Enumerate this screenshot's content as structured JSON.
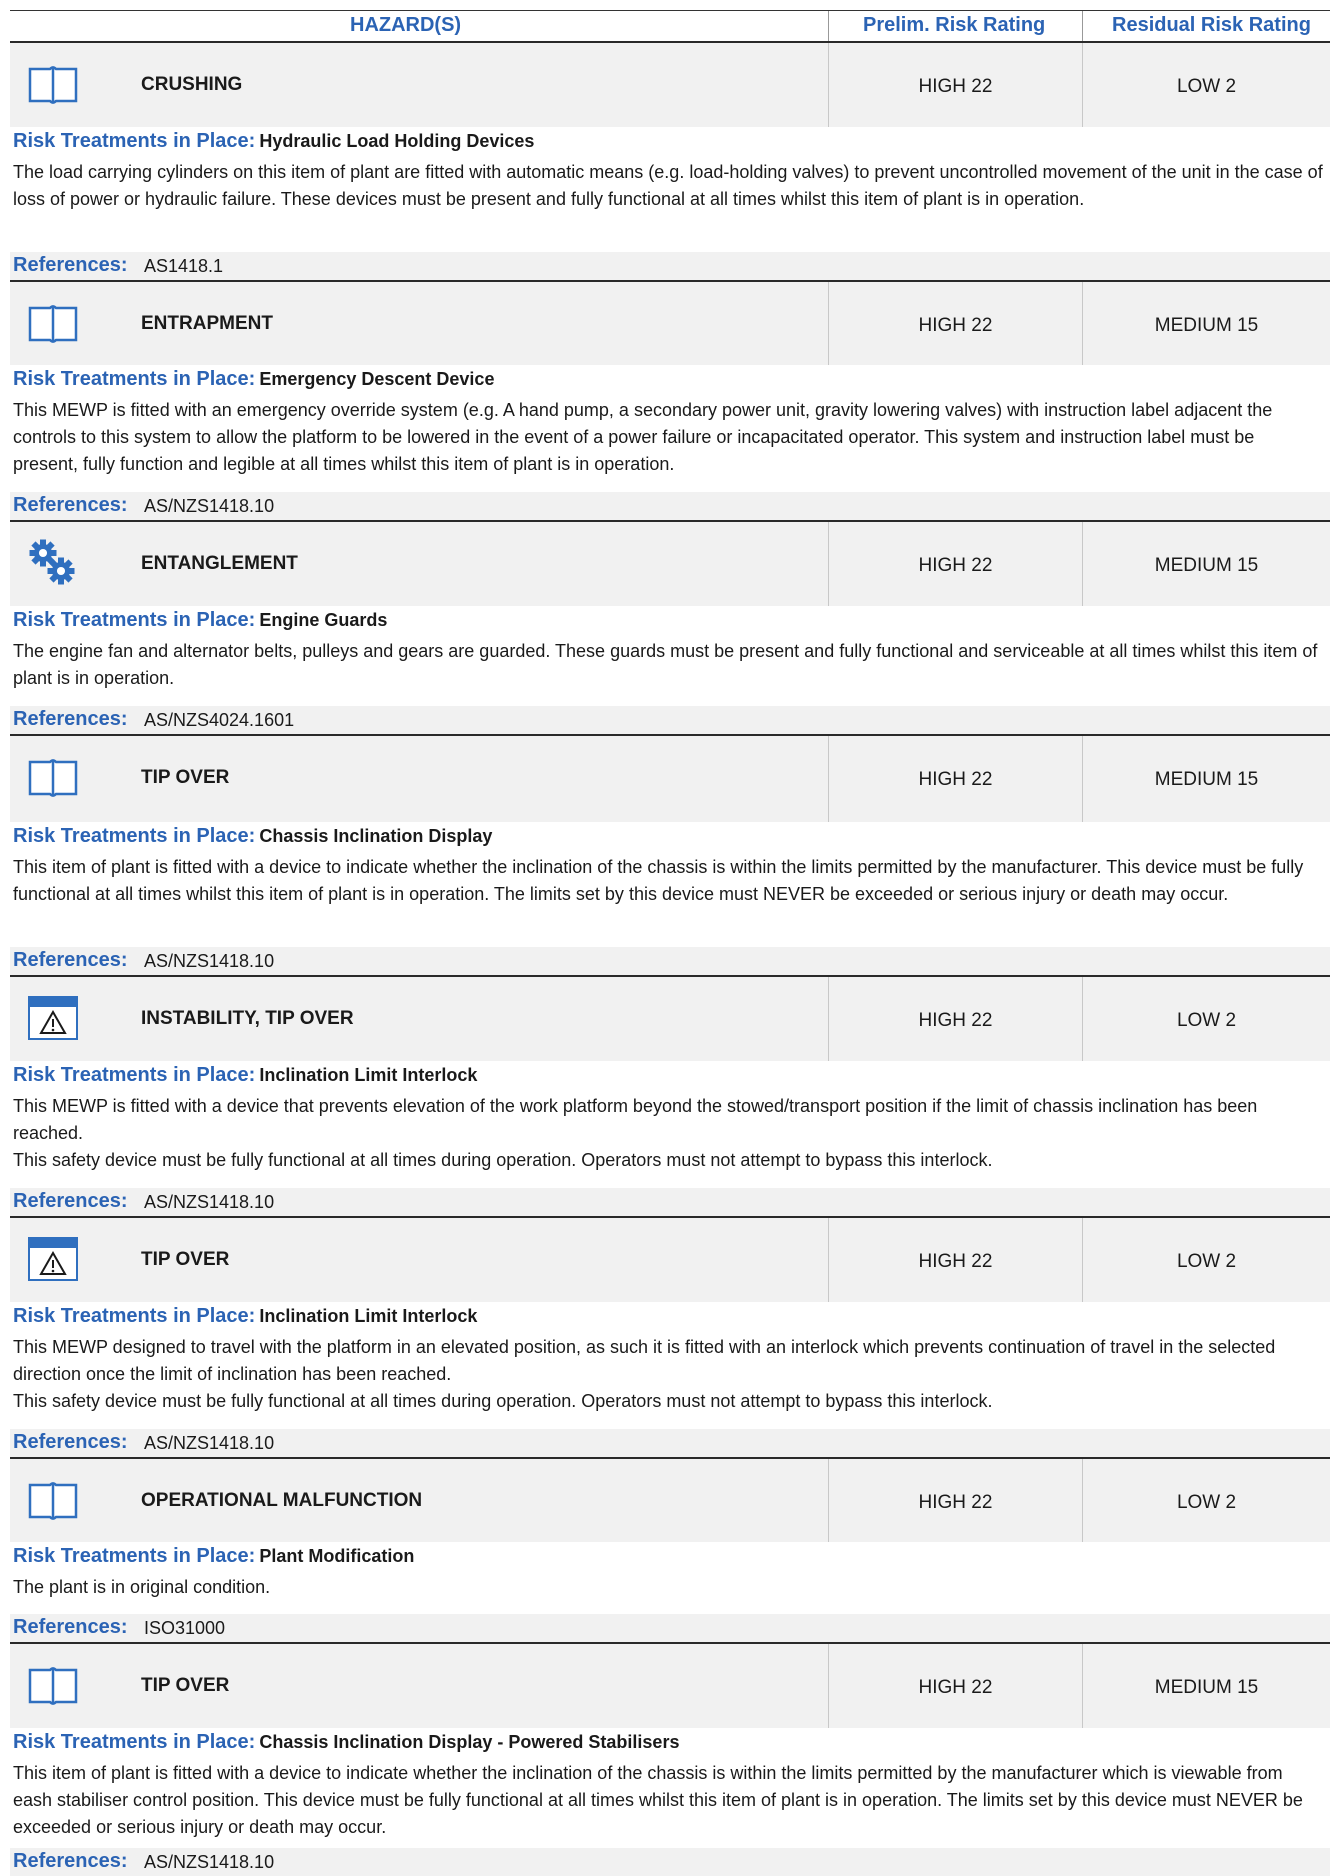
{
  "header": {
    "hazards": "HAZARD(S)",
    "prelim": "Prelim. Risk Rating",
    "residual": "Residual Risk Rating"
  },
  "labels": {
    "treatments": "Risk Treatments in Place:",
    "references": "References:"
  },
  "colors": {
    "accent": "#2b63b4",
    "icon_blue": "#2f6fbf"
  },
  "hazards": [
    {
      "icon": "manual-book-icon",
      "name": "CRUSHING",
      "prelim": "HIGH 22",
      "residual": "LOW 2",
      "treatment": "Hydraulic Load Holding Devices",
      "desc": [
        "The load carrying cylinders on this item of plant are fitted with automatic means (e.g. load-holding valves) to prevent uncontrolled movement of the unit in the case of loss of power or hydraulic failure. These devices must be present and fully functional at all times whilst this item of plant is in operation."
      ],
      "reference": "AS1418.1"
    },
    {
      "icon": "manual-book-icon",
      "name": "ENTRAPMENT",
      "prelim": "HIGH 22",
      "residual": "MEDIUM 15",
      "treatment": "Emergency Descent Device",
      "desc": [
        "This MEWP is fitted with an emergency override system (e.g. A hand pump, a secondary power unit, gravity lowering valves) with instruction label adjacent the controls to this system to allow the platform to be lowered in the event of a power failure or incapacitated operator. This system and instruction label must be present, fully function and legible at all times whilst this item of plant is in operation."
      ],
      "reference": "AS/NZS1418.10"
    },
    {
      "icon": "gears-icon",
      "name": "ENTANGLEMENT",
      "prelim": "HIGH 22",
      "residual": "MEDIUM 15",
      "treatment": "Engine Guards",
      "desc": [
        "The engine fan and alternator belts, pulleys and gears are guarded. These guards must be present and fully functional and serviceable at all times whilst this item of plant is in operation."
      ],
      "reference": "AS/NZS4024.1601"
    },
    {
      "icon": "manual-book-icon",
      "name": "TIP OVER",
      "prelim": "HIGH 22",
      "residual": "MEDIUM 15",
      "treatment": "Chassis Inclination Display",
      "desc": [
        "This item of plant is fitted with a device to indicate whether the inclination of the chassis is within the limits permitted by the manufacturer. This device must be fully functional at all times whilst this item of plant is in operation. The limits set by this device must NEVER be exceeded or serious injury or death may occur."
      ],
      "reference": "AS/NZS1418.10"
    },
    {
      "icon": "warning-sign-icon",
      "name": "INSTABILITY, TIP OVER",
      "prelim": "HIGH 22",
      "residual": "LOW 2",
      "treatment": "Inclination Limit Interlock",
      "desc": [
        "This MEWP is fitted with a device that prevents elevation of the work platform beyond the stowed/transport position if the limit of chassis inclination has been reached.",
        "This safety device must be fully functional at all times during operation. Operators must not attempt to bypass this interlock."
      ],
      "reference": "AS/NZS1418.10"
    },
    {
      "icon": "warning-sign-icon",
      "name": "TIP OVER",
      "prelim": "HIGH 22",
      "residual": "LOW 2",
      "treatment": "Inclination Limit Interlock",
      "desc": [
        "This MEWP designed to travel with the platform in an elevated position, as such it is fitted with an interlock which prevents continuation of travel in the selected direction once the limit of inclination has been reached.",
        "This safety device must be fully functional at all times during operation. Operators must not attempt to bypass this interlock."
      ],
      "reference": "AS/NZS1418.10"
    },
    {
      "icon": "manual-book-icon",
      "name": "OPERATIONAL MALFUNCTION",
      "prelim": "HIGH 22",
      "residual": "LOW 2",
      "treatment": "Plant Modification",
      "desc": [
        "The plant is in original condition."
      ],
      "reference": "ISO31000"
    },
    {
      "icon": "manual-book-icon",
      "name": "TIP OVER",
      "prelim": "HIGH 22",
      "residual": "MEDIUM 15",
      "treatment": "Chassis Inclination Display - Powered Stabilisers",
      "desc": [
        "This item of plant is fitted with a device to indicate whether the inclination of the chassis is within the limits permitted by the manufacturer which is viewable from eash stabiliser control position. This device must be fully functional at all times whilst this item of plant is in operation. The limits set by this device must NEVER be exceeded or serious injury or death may occur."
      ],
      "reference": "AS/NZS1418.10"
    }
  ]
}
